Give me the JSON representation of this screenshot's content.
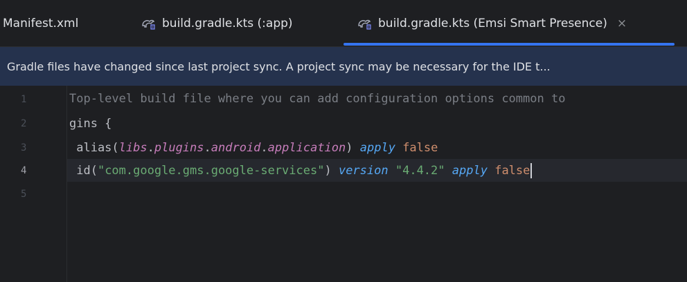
{
  "tabs": [
    {
      "label": "Manifest.xml",
      "icon": "none",
      "active": false
    },
    {
      "label": "build.gradle.kts (:app)",
      "icon": "gradle-icon",
      "active": false
    },
    {
      "label": "build.gradle.kts (Emsi Smart Presence)",
      "icon": "gradle-icon",
      "active": true,
      "close": "×"
    }
  ],
  "banner": {
    "text": "Gradle files have changed since last project sync. A project sync may be necessary for the IDE t..."
  },
  "editor": {
    "line_numbers": [
      "1",
      "2",
      "3",
      "4",
      "5"
    ],
    "current_line": "4",
    "lines": {
      "l1": {
        "comment": "Top-level build file where you can add configuration options common to"
      },
      "l2": {
        "a": "gins {"
      },
      "l3": {
        "a": " alias(",
        "b": "libs",
        "c": ".",
        "d": "plugins",
        "e": ".",
        "f": "android",
        "g": ".",
        "h": "application",
        "i": ") ",
        "j": "apply",
        "k": " ",
        "l": "false"
      },
      "l4": {
        "a": " id(",
        "b": "\"com.google.gms.google-services\"",
        "c": ") ",
        "d": "version",
        "e": " ",
        "f": "\"4.4.2\"",
        "g": " ",
        "h": "apply",
        "i": " ",
        "j": "false"
      }
    }
  },
  "colors": {
    "background": "#1e1f22",
    "banner": "#25324d",
    "accent": "#3574f0",
    "comment": "#7a7e85",
    "string": "#6aab73",
    "keyword": "#cf8e6d",
    "function": "#56a8f5",
    "property": "#c77dbb"
  }
}
